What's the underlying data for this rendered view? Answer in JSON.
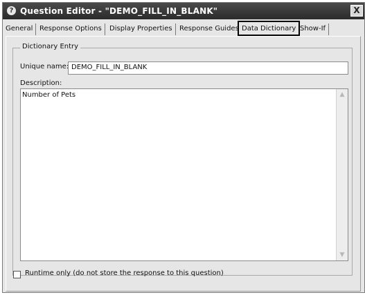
{
  "window": {
    "title": "Question Editor - \"DEMO_FILL_IN_BLANK\"",
    "close_glyph": "X",
    "help_glyph": "?"
  },
  "tabs": [
    {
      "label": "General",
      "selected": false
    },
    {
      "label": "Response Options",
      "selected": false
    },
    {
      "label": "Display Properties",
      "selected": false
    },
    {
      "label": "Response Guides",
      "selected": false
    },
    {
      "label": "Data Dictionary",
      "selected": true
    },
    {
      "label": "Show-If",
      "selected": false
    }
  ],
  "dictionary_entry": {
    "group_label": "Dictionary Entry",
    "unique_name_label": "Unique name:",
    "unique_name_value": "DEMO_FILL_IN_BLANK",
    "description_label": "Description:",
    "description_value": "Number of Pets",
    "scroll_up_glyph": "▲",
    "scroll_down_glyph": "▼"
  },
  "runtime_only": {
    "label": "Runtime only (do not store the response to this question)",
    "checked": false
  },
  "colors": {
    "titlebar": "#2b2b2b",
    "selected_tab_outline": "#000000",
    "window_background": "#e6e6e6"
  }
}
